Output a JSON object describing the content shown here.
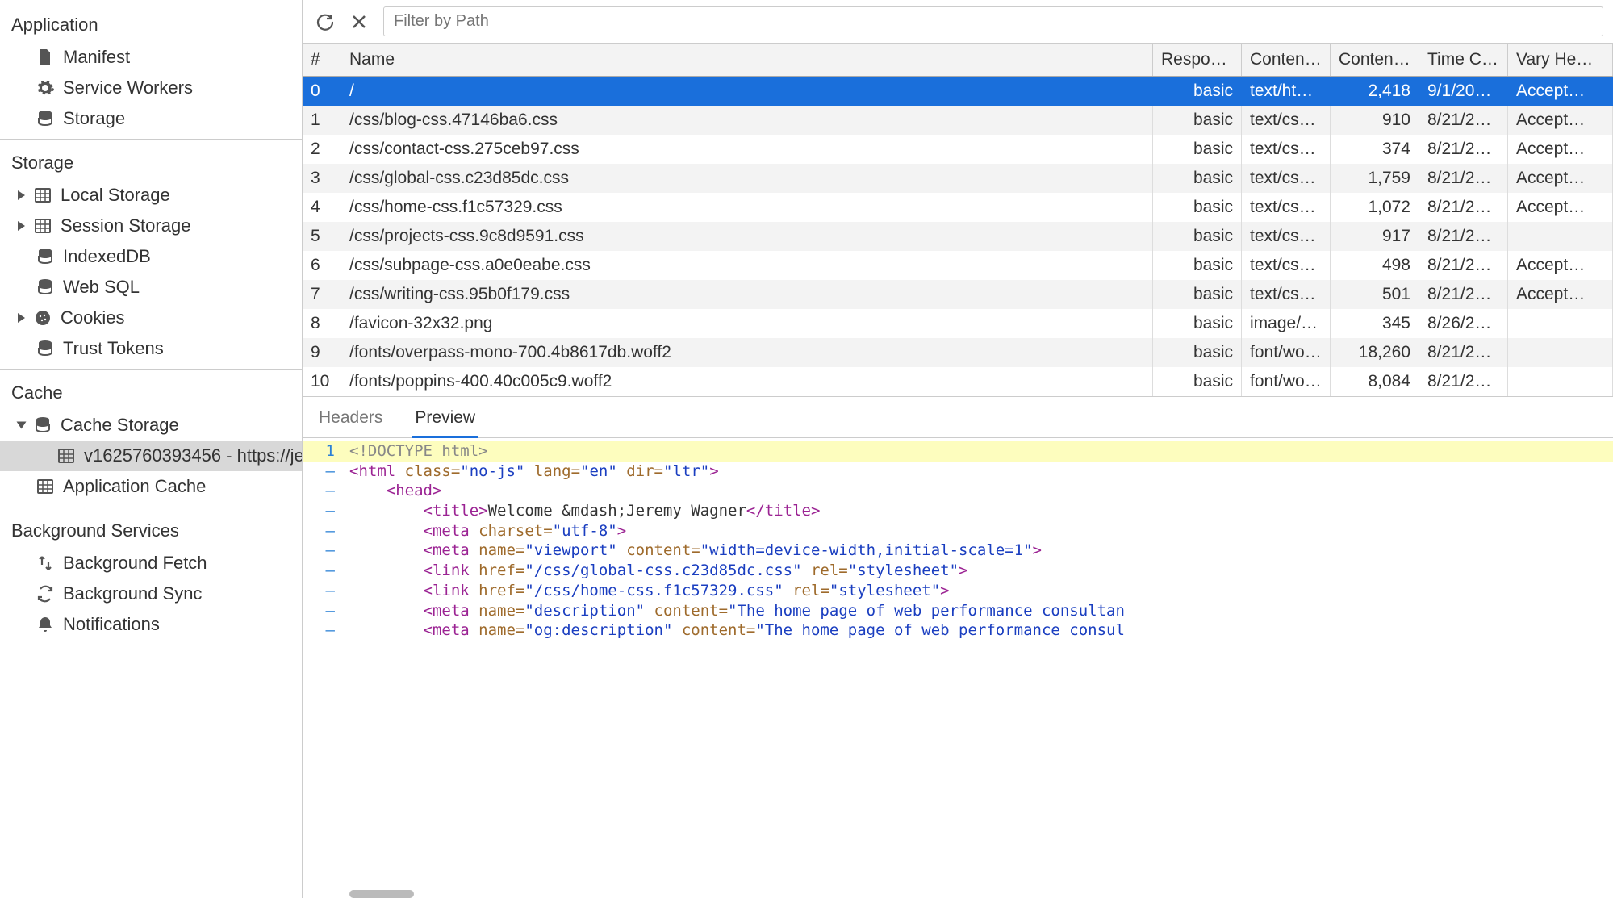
{
  "sidebar": {
    "sections": [
      {
        "title": "Application",
        "items": [
          {
            "icon": "file",
            "label": "Manifest"
          },
          {
            "icon": "gear",
            "label": "Service Workers"
          },
          {
            "icon": "db",
            "label": "Storage"
          }
        ]
      },
      {
        "title": "Storage",
        "items": [
          {
            "icon": "grid",
            "label": "Local Storage",
            "expandable": true
          },
          {
            "icon": "grid",
            "label": "Session Storage",
            "expandable": true
          },
          {
            "icon": "db",
            "label": "IndexedDB"
          },
          {
            "icon": "db",
            "label": "Web SQL"
          },
          {
            "icon": "cookie",
            "label": "Cookies",
            "expandable": true
          },
          {
            "icon": "db",
            "label": "Trust Tokens"
          }
        ]
      },
      {
        "title": "Cache",
        "items": [
          {
            "icon": "db",
            "label": "Cache Storage",
            "expandable": true,
            "expanded": true,
            "children": [
              {
                "icon": "grid",
                "label": "v1625760393456 - https://je",
                "selected": true
              }
            ]
          },
          {
            "icon": "grid",
            "label": "Application Cache"
          }
        ]
      },
      {
        "title": "Background Services",
        "items": [
          {
            "icon": "fetch",
            "label": "Background Fetch"
          },
          {
            "icon": "sync",
            "label": "Background Sync"
          },
          {
            "icon": "bell",
            "label": "Notifications"
          }
        ]
      }
    ]
  },
  "toolbar": {
    "filter_placeholder": "Filter by Path"
  },
  "table": {
    "columns": [
      "#",
      "Name",
      "Respo…",
      "Conten…",
      "Conten…",
      "Time C…",
      "Vary He…"
    ],
    "rows": [
      {
        "idx": "0",
        "name": "/",
        "resp": "basic",
        "ctype": "text/ht…",
        "clen": "2,418",
        "time": "9/1/20…",
        "vary": "Accept…",
        "selected": true
      },
      {
        "idx": "1",
        "name": "/css/blog-css.47146ba6.css",
        "resp": "basic",
        "ctype": "text/cs…",
        "clen": "910",
        "time": "8/21/2…",
        "vary": "Accept…"
      },
      {
        "idx": "2",
        "name": "/css/contact-css.275ceb97.css",
        "resp": "basic",
        "ctype": "text/cs…",
        "clen": "374",
        "time": "8/21/2…",
        "vary": "Accept…"
      },
      {
        "idx": "3",
        "name": "/css/global-css.c23d85dc.css",
        "resp": "basic",
        "ctype": "text/cs…",
        "clen": "1,759",
        "time": "8/21/2…",
        "vary": "Accept…"
      },
      {
        "idx": "4",
        "name": "/css/home-css.f1c57329.css",
        "resp": "basic",
        "ctype": "text/cs…",
        "clen": "1,072",
        "time": "8/21/2…",
        "vary": "Accept…"
      },
      {
        "idx": "5",
        "name": "/css/projects-css.9c8d9591.css",
        "resp": "basic",
        "ctype": "text/cs…",
        "clen": "917",
        "time": "8/21/2…",
        "vary": ""
      },
      {
        "idx": "6",
        "name": "/css/subpage-css.a0e0eabe.css",
        "resp": "basic",
        "ctype": "text/cs…",
        "clen": "498",
        "time": "8/21/2…",
        "vary": "Accept…"
      },
      {
        "idx": "7",
        "name": "/css/writing-css.95b0f179.css",
        "resp": "basic",
        "ctype": "text/cs…",
        "clen": "501",
        "time": "8/21/2…",
        "vary": "Accept…"
      },
      {
        "idx": "8",
        "name": "/favicon-32x32.png",
        "resp": "basic",
        "ctype": "image/…",
        "clen": "345",
        "time": "8/26/2…",
        "vary": ""
      },
      {
        "idx": "9",
        "name": "/fonts/overpass-mono-700.4b8617db.woff2",
        "resp": "basic",
        "ctype": "font/wo…",
        "clen": "18,260",
        "time": "8/21/2…",
        "vary": ""
      },
      {
        "idx": "10",
        "name": "/fonts/poppins-400.40c005c9.woff2",
        "resp": "basic",
        "ctype": "font/wo…",
        "clen": "8,084",
        "time": "8/21/2…",
        "vary": ""
      }
    ]
  },
  "detail": {
    "tabs": {
      "headers": "Headers",
      "preview": "Preview",
      "active": "preview"
    },
    "preview_lines": [
      {
        "n": "1",
        "tokens": [
          [
            "doctype",
            "<!DOCTYPE html>"
          ]
        ],
        "hl": true
      },
      {
        "n": "–",
        "tokens": [
          [
            "tag",
            "<html "
          ],
          [
            "attr",
            "class="
          ],
          [
            "str",
            "\"no-js\""
          ],
          [
            "tag",
            " "
          ],
          [
            "attr",
            "lang="
          ],
          [
            "str",
            "\"en\""
          ],
          [
            "tag",
            " "
          ],
          [
            "attr",
            "dir="
          ],
          [
            "str",
            "\"ltr\""
          ],
          [
            "tag",
            ">"
          ]
        ]
      },
      {
        "n": "–",
        "tokens": [
          [
            "txt",
            "    "
          ],
          [
            "tag",
            "<head>"
          ]
        ]
      },
      {
        "n": "–",
        "tokens": [
          [
            "txt",
            "        "
          ],
          [
            "tag",
            "<title>"
          ],
          [
            "txt",
            "Welcome &mdash;Jeremy Wagner"
          ],
          [
            "tag",
            "</title>"
          ]
        ]
      },
      {
        "n": "–",
        "tokens": [
          [
            "txt",
            "        "
          ],
          [
            "tag",
            "<meta "
          ],
          [
            "attr",
            "charset="
          ],
          [
            "str",
            "\"utf-8\""
          ],
          [
            "tag",
            ">"
          ]
        ]
      },
      {
        "n": "–",
        "tokens": [
          [
            "txt",
            "        "
          ],
          [
            "tag",
            "<meta "
          ],
          [
            "attr",
            "name="
          ],
          [
            "str",
            "\"viewport\""
          ],
          [
            "tag",
            " "
          ],
          [
            "attr",
            "content="
          ],
          [
            "str",
            "\"width=device-width,initial-scale=1\""
          ],
          [
            "tag",
            ">"
          ]
        ]
      },
      {
        "n": "–",
        "tokens": [
          [
            "txt",
            "        "
          ],
          [
            "tag",
            "<link "
          ],
          [
            "attr",
            "href="
          ],
          [
            "str",
            "\"/css/global-css.c23d85dc.css\""
          ],
          [
            "tag",
            " "
          ],
          [
            "attr",
            "rel="
          ],
          [
            "str",
            "\"stylesheet\""
          ],
          [
            "tag",
            ">"
          ]
        ]
      },
      {
        "n": "–",
        "tokens": [
          [
            "txt",
            "        "
          ],
          [
            "tag",
            "<link "
          ],
          [
            "attr",
            "href="
          ],
          [
            "str",
            "\"/css/home-css.f1c57329.css\""
          ],
          [
            "tag",
            " "
          ],
          [
            "attr",
            "rel="
          ],
          [
            "str",
            "\"stylesheet\""
          ],
          [
            "tag",
            ">"
          ]
        ]
      },
      {
        "n": "–",
        "tokens": [
          [
            "txt",
            "        "
          ],
          [
            "tag",
            "<meta "
          ],
          [
            "attr",
            "name="
          ],
          [
            "str",
            "\"description\""
          ],
          [
            "tag",
            " "
          ],
          [
            "attr",
            "content="
          ],
          [
            "str",
            "\"The home page of web performance consultan"
          ]
        ]
      },
      {
        "n": "–",
        "tokens": [
          [
            "txt",
            "        "
          ],
          [
            "tag",
            "<meta "
          ],
          [
            "attr",
            "name="
          ],
          [
            "str",
            "\"og:description\""
          ],
          [
            "tag",
            " "
          ],
          [
            "attr",
            "content="
          ],
          [
            "str",
            "\"The home page of web performance consul"
          ]
        ]
      }
    ]
  }
}
